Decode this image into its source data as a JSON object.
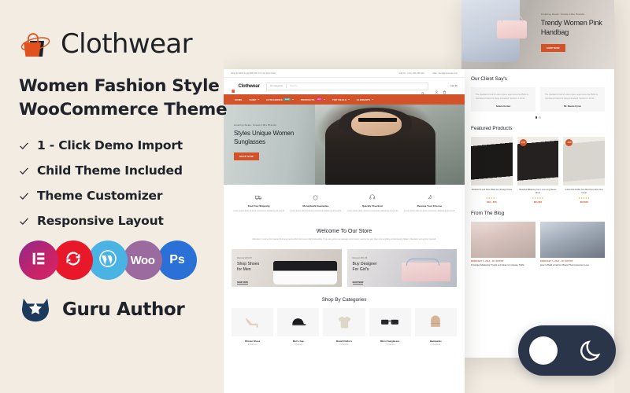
{
  "theme": {
    "bg": "#f2ece3",
    "accent": "#d2532a",
    "dark": "#2b3549",
    "text": "#20232a"
  },
  "promo": {
    "brand_name": "Clothwear",
    "brand_logo_icon": "handbag-icon",
    "tagline_line1": "Women Fashion Style",
    "tagline_line2": "WooCommerce Theme",
    "features": [
      {
        "label": "1 - Click Demo Import",
        "icon": "check-icon"
      },
      {
        "label": "Child Theme Included",
        "icon": "check-icon"
      },
      {
        "label": "Theme Customizer",
        "icon": "check-icon"
      },
      {
        "label": "Responsive Layout",
        "icon": "check-icon"
      }
    ],
    "badges": [
      {
        "name": "elementor-badge",
        "label": "",
        "icon": "elementor-icon",
        "color": "#c62368"
      },
      {
        "name": "refresh-badge",
        "label": "",
        "icon": "refresh-icon",
        "color": "#e8172a"
      },
      {
        "name": "wordpress-badge",
        "label": "",
        "icon": "wordpress-icon",
        "color": "#49b3e4"
      },
      {
        "name": "woocommerce-badge",
        "label": "Woo",
        "icon": "woo-icon",
        "color": "#9b6a9e"
      },
      {
        "name": "photoshop-badge",
        "label": "Ps",
        "icon": "photoshop-icon",
        "color": "#2b70d6"
      }
    ],
    "author_label": "Guru Author",
    "author_icon": "cat-star-icon"
  },
  "site": {
    "topbar": {
      "shipping": "Shop for $100 & get $20 OFF On Your First Order",
      "call_label": "Call Us : (+91) 456 789 100",
      "email_label": "Mail : demo@example.com"
    },
    "header": {
      "logo_text": "Clothwear",
      "category_select": "All Categories",
      "search_placeholder": "Search...",
      "cart_label": "Cart (0)",
      "icons": [
        "search-icon",
        "user-icon",
        "cart-icon"
      ]
    },
    "nav": [
      {
        "label": "HOME",
        "tag": "",
        "caret": false
      },
      {
        "label": "SHOP",
        "tag": "",
        "caret": true
      },
      {
        "label": "CATEGORIES",
        "tag": "NEW",
        "caret": true
      },
      {
        "label": "PRODUCTS",
        "tag": "HOT",
        "caret": true
      },
      {
        "label": "TOP DEALS",
        "tag": "",
        "caret": true
      },
      {
        "label": "ELEMENTS",
        "tag": "",
        "caret": true
      }
    ],
    "hero": {
      "eyebrow": "Amazing Deals. Create 100+ Brands.",
      "title_line1": "Styles Unique Women",
      "title_line2": "Sunglasses",
      "button": "SHOP NOW"
    },
    "services": [
      {
        "icon": "truck-icon",
        "title": "Fast Free Shipping",
        "desc": "Lorem ipsum dolor sit amet consectetur adipiscing elit sed do"
      },
      {
        "icon": "shield-icon",
        "title": "Moneyback Guarantee",
        "desc": "Lorem ipsum dolor sit amet consectetur adipiscing elit sed do"
      },
      {
        "icon": "headset-icon",
        "title": "Quickly Checkout",
        "desc": "Lorem ipsum dolor sit amet consectetur adipiscing elit sed do"
      },
      {
        "icon": "rocket-icon",
        "title": "Receive Your Choose",
        "desc": "Lorem ipsum dolor sit amet consectetur adipiscing elit sed do"
      }
    ],
    "welcome": {
      "title": "Welcome To Our Store",
      "desc": "Alteration in some form injected humour words which dont even slight believable. If you are going use passage orem ipsum need to be sure there isnt anything embarrassing hidden. Alteration some form injected."
    },
    "promos": [
      {
        "eyebrow": "Discount 20% Off",
        "title_line1": "Shop Shoes",
        "title_line2": "for Men",
        "link": "SHOP NOW"
      },
      {
        "eyebrow": "Discount 20% Off",
        "title_line1": "Buy Designer",
        "title_line2": "For Girl's",
        "link": "SHOP NOW"
      }
    ],
    "categories": {
      "title": "Shop By Categories",
      "items": [
        {
          "name": "Women Shoes",
          "count": "4 Products",
          "icon": "high-heel-icon"
        },
        {
          "name": "Men's Cap",
          "count": "1 Products",
          "icon": "cap-icon"
        },
        {
          "name": "Brand Clothe's",
          "count": "3 Products",
          "icon": "tshirt-icon"
        },
        {
          "name": "Mirror Sunglasses",
          "count": "7 Products",
          "icon": "sunglasses-icon"
        },
        {
          "name": "Backpacks",
          "count": "2 Products",
          "icon": "backpack-icon"
        }
      ]
    }
  },
  "right_panel": {
    "banner": {
      "eyebrow": "Amazing Deals. Create 100+ Brands.",
      "title_line1": "Trendy Women Pink",
      "title_line2": "Handbag",
      "button": "SHOP NOW"
    },
    "testimonials": {
      "title": "Our Client Say's",
      "items": [
        {
          "quote": "The standard chunk of Lorem Ipsum used since the 1500s is reproduced below for those interested. Sections 1.10.32...",
          "name": "Selena Gomez"
        },
        {
          "quote": "The standard chunk of Lorem Ipsum used since the 1500s is reproduced below for those interested. Sections 1.10.32...",
          "name": "Mr. Reema Cyrus"
        }
      ]
    },
    "featured": {
      "title": "Featured Products",
      "items": [
        {
          "name": "Abstract Fit and Flare Black And Design Dress",
          "stars": "★★★★☆",
          "price": "$49 – $55",
          "badge": ""
        },
        {
          "name": "Beautiful Billabong Your Love Long Sleeve Dress",
          "stars": "★★★★★",
          "price": "$64 $56",
          "badge": "-15%"
        },
        {
          "name": "Cotton Eris Ruffle Trim Mini Dress Eris Grey Floral",
          "stars": "★★★★★",
          "price": "$60 $58",
          "badge": "-15%"
        }
      ]
    },
    "blog": {
      "title": "From The Blog",
      "items": [
        {
          "meta": "FEBRUARY 5, 2024 – BY EDITOR",
          "title": "9 Content Marketing Trends and Ideas to Increase Traffic"
        },
        {
          "meta": "FEBRUARY 5, 2024 – BY EDITOR",
          "title": "How to Build a Fashion Brand That Customers Love"
        }
      ]
    }
  },
  "mode_toggle": {
    "light_icon": "sun-icon",
    "dark_icon": "moon-icon"
  }
}
